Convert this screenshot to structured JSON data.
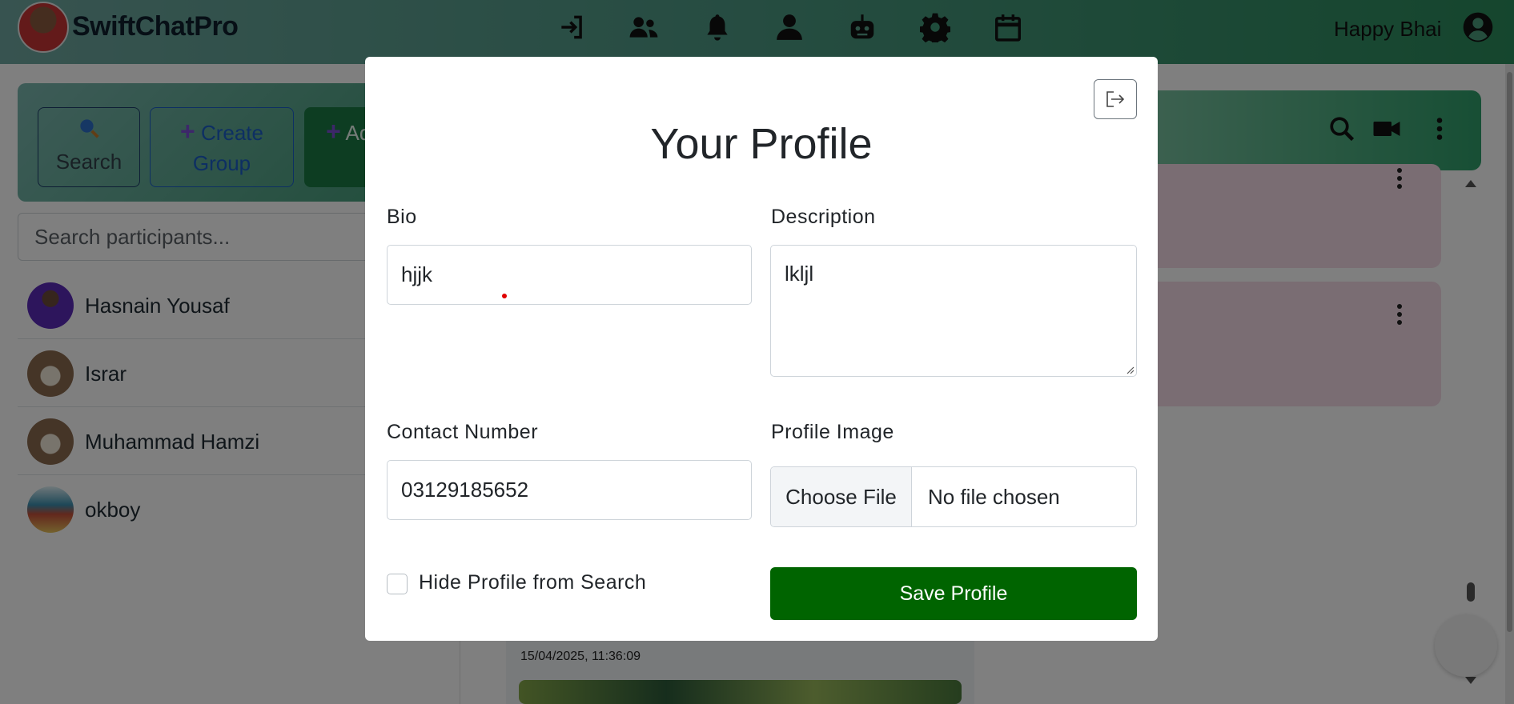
{
  "app": {
    "brand": "SwiftChatPro",
    "user_name": "Happy Bhai"
  },
  "nav": {
    "icons": [
      "sign-in-icon",
      "users-icon",
      "bell-icon",
      "user-icon",
      "robot-icon",
      "gear-icon",
      "calendar-icon"
    ]
  },
  "sidebar": {
    "actions": [
      {
        "label": "Search",
        "icon": "search-icon"
      },
      {
        "label": "Create Group",
        "icon": "plus-icon"
      },
      {
        "label": "Add Users",
        "icon": "plus-icon"
      }
    ],
    "search_placeholder": "Search participants...",
    "participants": [
      "Hasnain Yousaf",
      "Israr",
      "Muhammad Hamzi",
      "okboy"
    ]
  },
  "chat": {
    "timestamp": "15/04/2025, 11:36:09"
  },
  "modal": {
    "title": "Your Profile",
    "bio": {
      "label": "Bio",
      "value": "hjjk"
    },
    "description": {
      "label": "Description",
      "value": "lkljl"
    },
    "contact": {
      "label": "Contact Number",
      "value": "03129185652"
    },
    "profile_image": {
      "label": "Profile Image",
      "button": "Choose File",
      "status": "No file chosen"
    },
    "hide_profile": {
      "label": "Hide Profile from Search",
      "checked": false
    },
    "save_label": "Save Profile"
  },
  "colors": {
    "save_button": "#006400",
    "navbar_start": "#6fa7a0",
    "navbar_end": "#2b8c5c",
    "backdrop": "rgba(0,0,0,0.5)"
  }
}
